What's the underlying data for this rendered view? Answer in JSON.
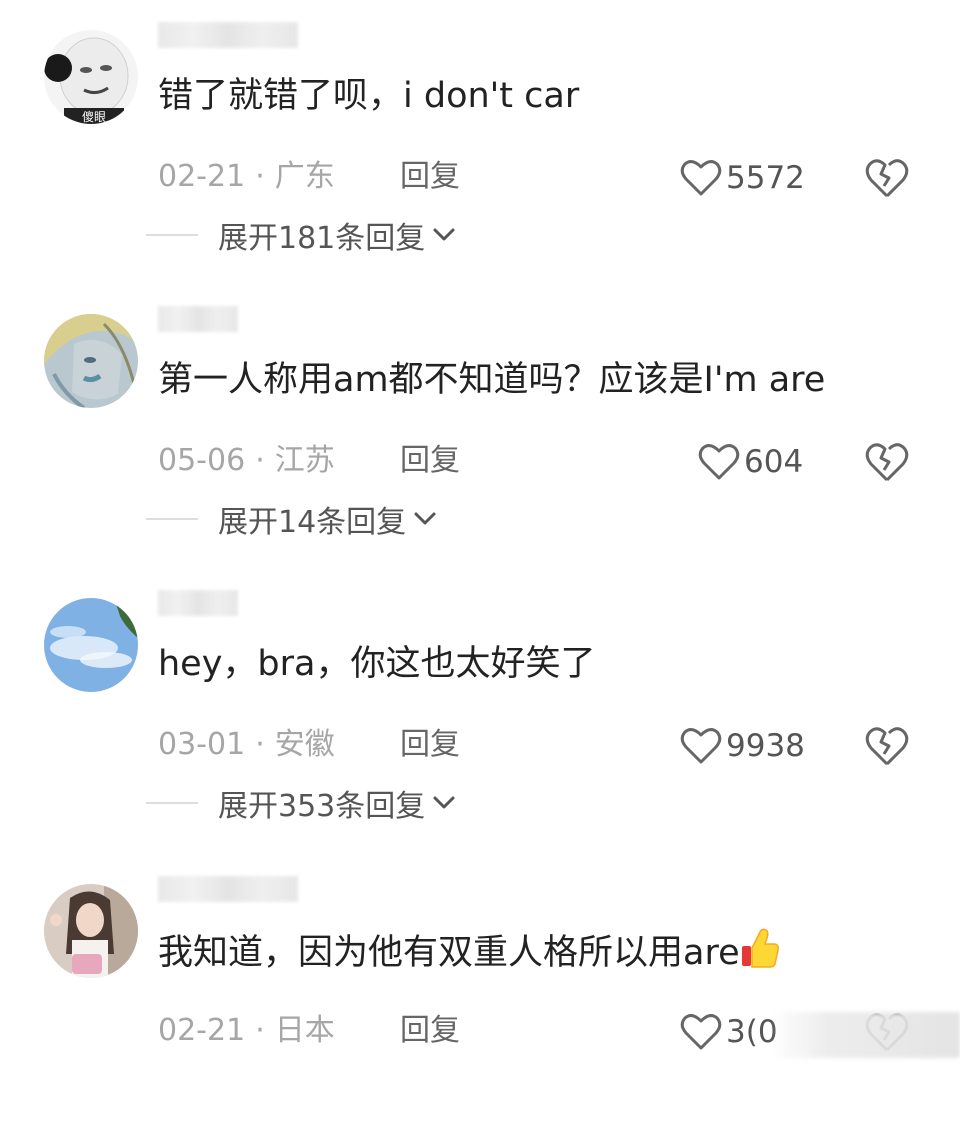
{
  "comments": [
    {
      "content": "错了就错了呗，i don't car",
      "date": "02-21",
      "location": "广东",
      "reply_label": "回复",
      "likes": "5572",
      "expand_label": "展开181条回复"
    },
    {
      "content": "第一人称用am都不知道吗？应该是I'm are",
      "date": "05-06",
      "location": "江苏",
      "reply_label": "回复",
      "likes": "604",
      "expand_label": "展开14条回复"
    },
    {
      "content": "hey，bra，你这也太好笑了",
      "date": "03-01",
      "location": "安徽",
      "reply_label": "回复",
      "likes": "9938",
      "expand_label": "展开353条回复"
    },
    {
      "content": "我知道，因为他有双重人格所以用are",
      "date": "02-21",
      "location": "日本",
      "reply_label": "回复",
      "likes": "3(0"
    }
  ],
  "avatar_text": "傻眼",
  "meta_separator": "·",
  "colors": {
    "text_primary": "#222222",
    "text_secondary": "#a6a6a6",
    "icon": "#666666"
  }
}
